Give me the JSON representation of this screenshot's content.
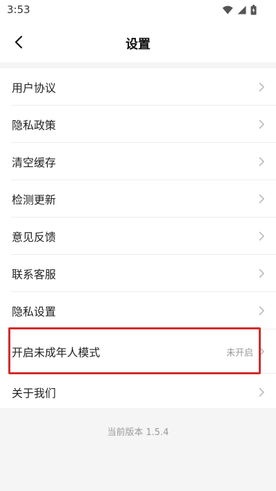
{
  "status_bar": {
    "time": "3:53",
    "icons": [
      "wifi-icon",
      "cellular-signal-icon",
      "battery-icon"
    ]
  },
  "header": {
    "title": "设置",
    "back_icon": "chevron-left-icon"
  },
  "settings": {
    "items": [
      {
        "label": "用户协议",
        "value": ""
      },
      {
        "label": "隐私政策",
        "value": ""
      },
      {
        "label": "清空缓存",
        "value": ""
      },
      {
        "label": "检测更新",
        "value": ""
      },
      {
        "label": "意见反馈",
        "value": ""
      },
      {
        "label": "联系客服",
        "value": ""
      },
      {
        "label": "隐私设置",
        "value": ""
      },
      {
        "label": "开启未成年人模式",
        "value": "未开启"
      },
      {
        "label": "关于我们",
        "value": ""
      }
    ]
  },
  "footer": {
    "version": "当前版本 1.5.4"
  },
  "colors": {
    "highlight": "#d42a2a",
    "background": "#f5f5f5",
    "secondary_text": "#999999"
  }
}
